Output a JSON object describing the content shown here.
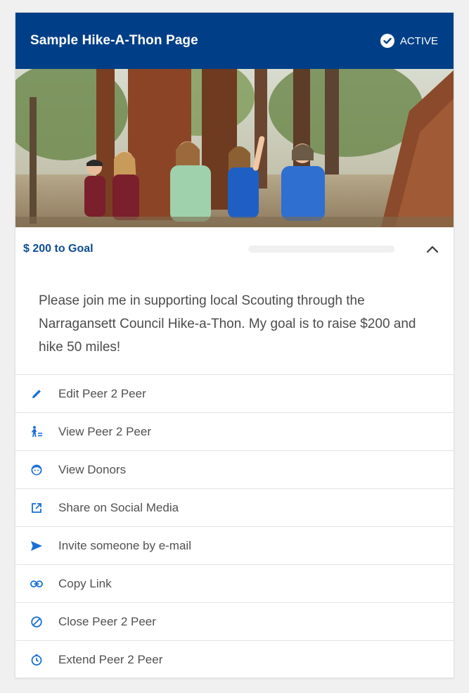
{
  "header": {
    "title": "Sample Hike-A-Thon Page",
    "status": "ACTIVE",
    "status_icon": "check-circle-icon",
    "background": "#003f87"
  },
  "goal": {
    "label": "$ 200 to Goal",
    "progress_fraction": 0,
    "expanded": true
  },
  "description": "Please join me in supporting local Scouting through the Narragansett Council Hike-a-Thon. My goal is to raise $200 and hike 50 miles!",
  "actions": [
    {
      "label": "Edit Peer 2 Peer",
      "icon": "pencil-icon"
    },
    {
      "label": "View Peer 2 Peer",
      "icon": "hiker-icon"
    },
    {
      "label": "View Donors",
      "icon": "face-icon"
    },
    {
      "label": "Share on Social Media",
      "icon": "external-link-icon"
    },
    {
      "label": "Invite someone by e-mail",
      "icon": "send-icon"
    },
    {
      "label": "Copy Link",
      "icon": "link-icon"
    },
    {
      "label": "Close Peer 2 Peer",
      "icon": "block-icon"
    },
    {
      "label": "Extend Peer 2 Peer",
      "icon": "timer-icon"
    }
  ],
  "colors": {
    "accent": "#0d4d91",
    "icon": "#1a6fd6"
  }
}
